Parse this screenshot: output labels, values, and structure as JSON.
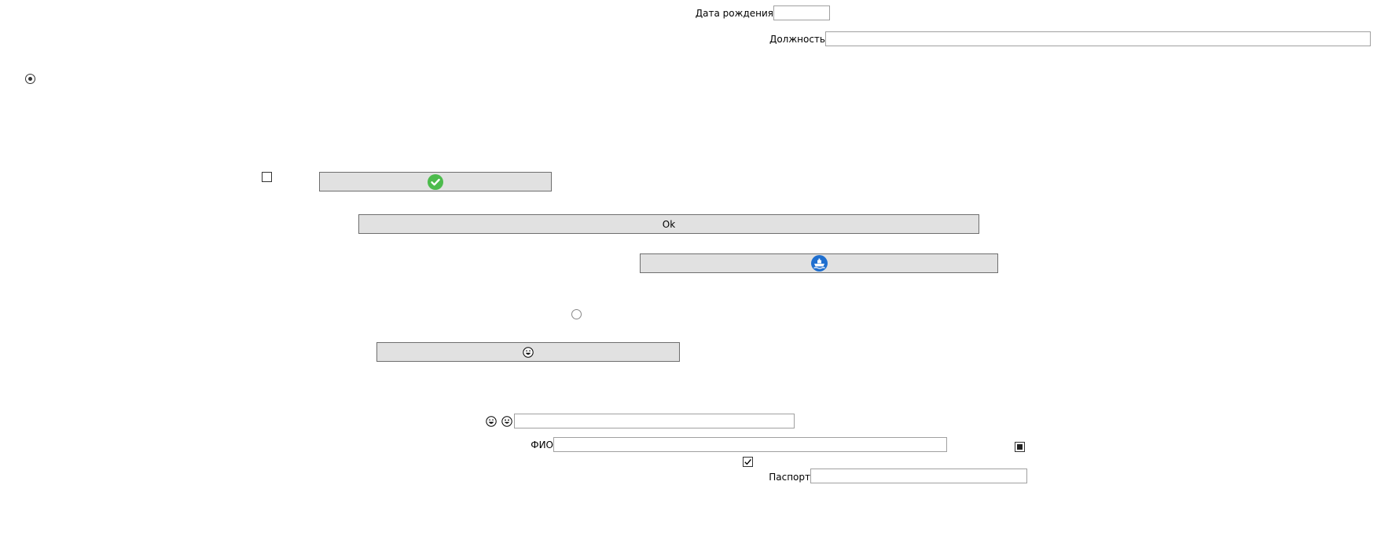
{
  "form": {
    "birth_date_label": "Дата рождения",
    "birth_date_value": "",
    "position_label": "Должность",
    "position_value": "",
    "fio_label": "ФИО",
    "fio_value": "",
    "passport_label": "Паспорт",
    "passport_value": "",
    "emoji_field_value": ""
  },
  "buttons": {
    "check_button_icon": "green-check-circle-icon",
    "ok_label": "Ok",
    "ship_button_icon": "blue-ship-circle-icon",
    "emoji_button_icon": "grinning-face-icon"
  },
  "controls": {
    "radio_top_checked": true,
    "radio_middle_checked": false,
    "checkbox_left_checked": false,
    "checkbox_bottom_checked": true,
    "checkbox_right_state": "indeterminate"
  },
  "colors": {
    "button_bg": "#e1e1e1",
    "button_border": "#6e6e6e",
    "textbox_border": "#a0a0a0",
    "check_green": "#4cbb4c",
    "ship_blue": "#1f6fcf"
  }
}
